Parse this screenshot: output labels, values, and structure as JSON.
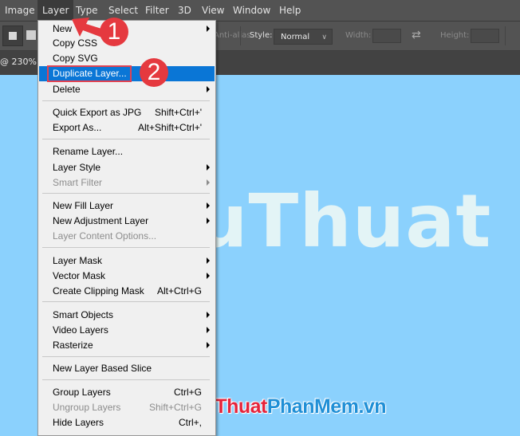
{
  "menubar": {
    "items": [
      "Image",
      "Layer",
      "Type",
      "Select",
      "Filter",
      "3D",
      "View",
      "Window",
      "Help"
    ],
    "active": "Layer"
  },
  "options_bar": {
    "antialias_label": "Anti-alias",
    "style_label": "Style:",
    "style_value": "Normal",
    "width_label": "Width:",
    "height_label": "Height:",
    "width_value": "",
    "height_value": ""
  },
  "document_tab": {
    "title": "@ 230% ("
  },
  "canvas": {
    "text": "uThuat",
    "background": "#8bd1fd"
  },
  "layer_menu": {
    "items": [
      {
        "label": "New",
        "shortcut": "",
        "submenu": true,
        "disabled": false
      },
      {
        "label": "Copy CSS",
        "shortcut": "",
        "submenu": false,
        "disabled": false
      },
      {
        "label": "Copy SVG",
        "shortcut": "",
        "submenu": false,
        "disabled": false
      },
      {
        "label": "Duplicate Layer...",
        "shortcut": "",
        "submenu": false,
        "disabled": false,
        "highlighted": true
      },
      {
        "label": "Delete",
        "shortcut": "",
        "submenu": true,
        "disabled": false
      },
      {
        "label": "Quick Export as JPG",
        "shortcut": "Shift+Ctrl+'",
        "submenu": false,
        "disabled": false
      },
      {
        "label": "Export As...",
        "shortcut": "Alt+Shift+Ctrl+'",
        "submenu": false,
        "disabled": false
      },
      {
        "label": "Rename Layer...",
        "shortcut": "",
        "submenu": false,
        "disabled": false
      },
      {
        "label": "Layer Style",
        "shortcut": "",
        "submenu": true,
        "disabled": false
      },
      {
        "label": "Smart Filter",
        "shortcut": "",
        "submenu": true,
        "disabled": true
      },
      {
        "label": "New Fill Layer",
        "shortcut": "",
        "submenu": true,
        "disabled": false
      },
      {
        "label": "New Adjustment Layer",
        "shortcut": "",
        "submenu": true,
        "disabled": false
      },
      {
        "label": "Layer Content Options...",
        "shortcut": "",
        "submenu": false,
        "disabled": true
      },
      {
        "label": "Layer Mask",
        "shortcut": "",
        "submenu": true,
        "disabled": false
      },
      {
        "label": "Vector Mask",
        "shortcut": "",
        "submenu": true,
        "disabled": false
      },
      {
        "label": "Create Clipping Mask",
        "shortcut": "Alt+Ctrl+G",
        "submenu": false,
        "disabled": false
      },
      {
        "label": "Smart Objects",
        "shortcut": "",
        "submenu": true,
        "disabled": false
      },
      {
        "label": "Video Layers",
        "shortcut": "",
        "submenu": true,
        "disabled": false
      },
      {
        "label": "Rasterize",
        "shortcut": "",
        "submenu": true,
        "disabled": false
      },
      {
        "label": "New Layer Based Slice",
        "shortcut": "",
        "submenu": false,
        "disabled": false
      },
      {
        "label": "Group Layers",
        "shortcut": "Ctrl+G",
        "submenu": false,
        "disabled": false
      },
      {
        "label": "Ungroup Layers",
        "shortcut": "Shift+Ctrl+G",
        "submenu": false,
        "disabled": true
      },
      {
        "label": "Hide Layers",
        "shortcut": "Ctrl+,",
        "submenu": false,
        "disabled": false
      }
    ]
  },
  "annotations": {
    "step1": "1",
    "step2": "2",
    "color": "#e5393f"
  },
  "watermark": {
    "part1": "ThuThuat",
    "part2": "PhanMem.vn",
    "color1": "#e5243b",
    "color2": "#1f8fd6"
  },
  "colors": {
    "menu_highlight": "#0a76d6",
    "toolbar_bg": "#535353"
  }
}
